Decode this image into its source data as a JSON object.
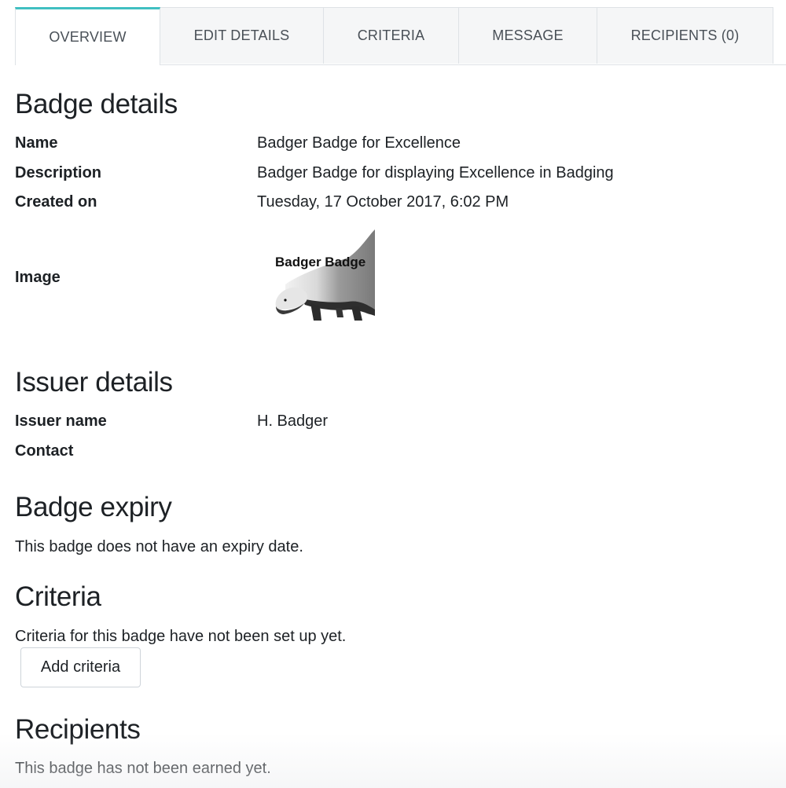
{
  "tabs": [
    {
      "label": "OVERVIEW",
      "active": true
    },
    {
      "label": "EDIT DETAILS",
      "active": false
    },
    {
      "label": "CRITERIA",
      "active": false
    },
    {
      "label": "MESSAGE",
      "active": false
    },
    {
      "label": "RECIPIENTS (0)",
      "active": false
    }
  ],
  "badge_details": {
    "heading": "Badge details",
    "name_label": "Name",
    "name_value": "Badger Badge for Excellence",
    "description_label": "Description",
    "description_value": "Badger Badge for displaying Excellence in Badging",
    "created_label": "Created on",
    "created_value": "Tuesday, 17 October 2017, 6:02 PM",
    "image_label": "Image",
    "image_caption": "Badger Badge"
  },
  "issuer_details": {
    "heading": "Issuer details",
    "issuer_name_label": "Issuer name",
    "issuer_name_value": "H. Badger",
    "contact_label": "Contact"
  },
  "expiry": {
    "heading": "Badge expiry",
    "text": "This badge does not have an expiry date."
  },
  "criteria": {
    "heading": "Criteria",
    "text": "Criteria for this badge have not been set up yet.",
    "add_button": "Add criteria"
  },
  "recipients": {
    "heading": "Recipients",
    "text": "This badge has not been earned yet."
  },
  "colors": {
    "active_tab_accent": "#40bfc1",
    "tab_background": "#f5f6f7",
    "text": "#1d2125"
  }
}
